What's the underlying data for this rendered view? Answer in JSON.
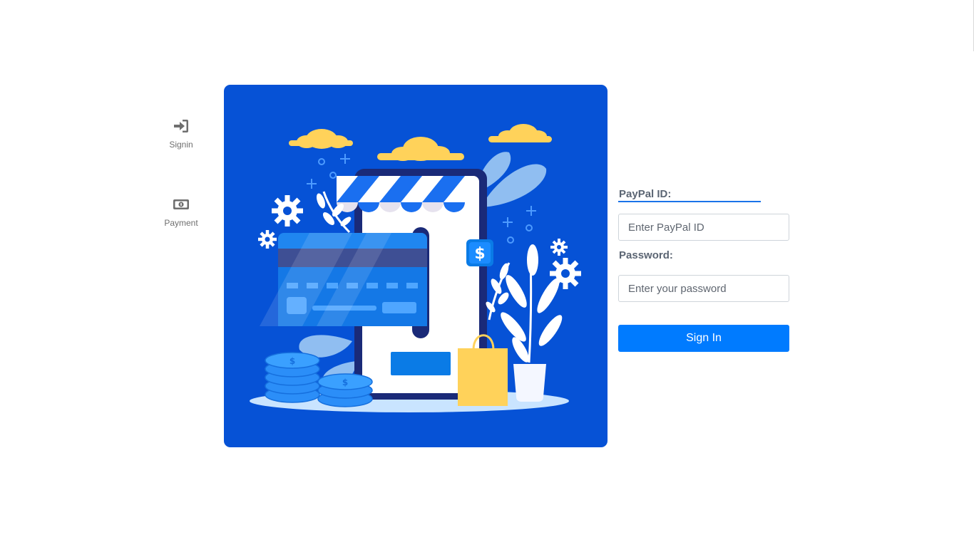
{
  "nav": {
    "items": [
      {
        "label": "Signin",
        "icon": "sign-in-icon"
      },
      {
        "label": "Payment",
        "icon": "money-bill-icon"
      }
    ]
  },
  "hero": {
    "icon": "online-shop-illustration",
    "colors": {
      "background": "#0652d6",
      "accent": "#ffd25a",
      "coin": "#3a9cff"
    }
  },
  "form": {
    "paypal_label": "PayPal ID:",
    "paypal_placeholder": "Enter PayPal ID",
    "paypal_value": "",
    "password_label": "Password:",
    "password_placeholder": "Enter your password",
    "password_value": "",
    "submit_label": "Sign In"
  },
  "colors": {
    "primary": "#007bff",
    "label": "#5b6573",
    "nav": "#6f6f6f"
  }
}
